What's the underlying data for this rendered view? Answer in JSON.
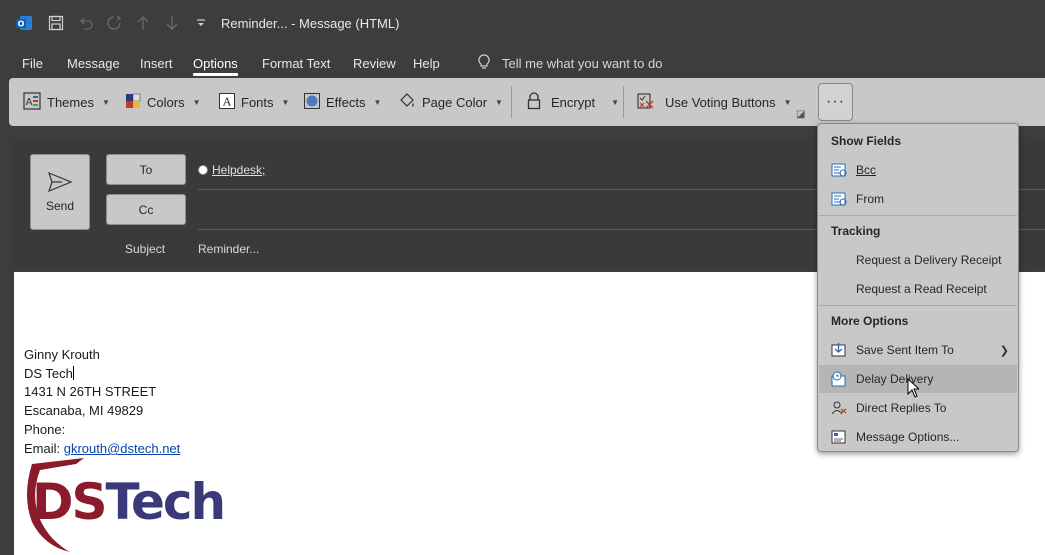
{
  "window": {
    "title": "Reminder...  -  Message (HTML)"
  },
  "menu": {
    "tabs": [
      {
        "label": "File"
      },
      {
        "label": "Message"
      },
      {
        "label": "Insert"
      },
      {
        "label": "Options"
      },
      {
        "label": "Format Text"
      },
      {
        "label": "Review"
      },
      {
        "label": "Help"
      }
    ],
    "active_tab": "Options",
    "tell_me": "Tell me what you want to do"
  },
  "ribbon": {
    "themes": "Themes",
    "colors": "Colors",
    "fonts": "Fonts",
    "effects": "Effects",
    "page_color": "Page Color",
    "encrypt": "Encrypt",
    "voting": "Use Voting Buttons",
    "more": "···"
  },
  "header": {
    "send": "Send",
    "to": "To",
    "cc": "Cc",
    "subject_label": "Subject",
    "subject_value": "Reminder...",
    "recipient": "Helpdesk;"
  },
  "signature": {
    "name": "Ginny Krouth",
    "company": "DS Tech",
    "street": "1431 N 26TH STREET",
    "city": "Escanaba, MI 49829",
    "phone": "Phone:",
    "email_label": "Email: ",
    "email": "gkrouth@dstech.net",
    "logo_ds": "DS",
    "logo_tech": "Tech"
  },
  "dropdown": {
    "show_fields": "Show Fields",
    "bcc": "Bcc",
    "from": "From",
    "tracking": "Tracking",
    "delivery_receipt": "Request a Delivery Receipt",
    "read_receipt": "Request a Read Receipt",
    "more_options": "More Options",
    "save_sent": "Save Sent Item To",
    "delay_delivery": "Delay Delivery",
    "direct_replies": "Direct Replies To",
    "message_options": "Message Options..."
  },
  "colors": {
    "accent_red": "#8b1a2b",
    "logo_navy": "#3a3a7a",
    "link": "#0645ad"
  }
}
